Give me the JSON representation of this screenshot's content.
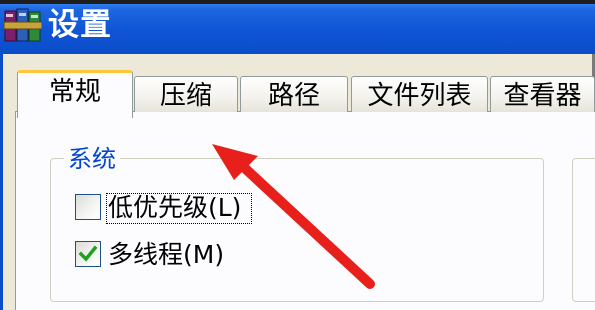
{
  "window": {
    "title": "设置",
    "icon": "winrar-books-icon"
  },
  "tabs": [
    {
      "label": "常规",
      "active": true
    },
    {
      "label": "压缩",
      "active": false
    },
    {
      "label": "路径",
      "active": false
    },
    {
      "label": "文件列表",
      "active": false
    },
    {
      "label": "查看器",
      "active": false
    }
  ],
  "system_group": {
    "title": "系统",
    "options": [
      {
        "label": "低优先级(L)",
        "checked": false
      },
      {
        "label": "多线程(M)",
        "checked": true
      }
    ]
  },
  "annotation": {
    "arrow_color": "#E8201C"
  },
  "colors": {
    "titlebar": "#0F55D6",
    "group_title": "#0046D5",
    "active_tab_accent": "#FFC83C",
    "check_mark": "#21A121"
  }
}
